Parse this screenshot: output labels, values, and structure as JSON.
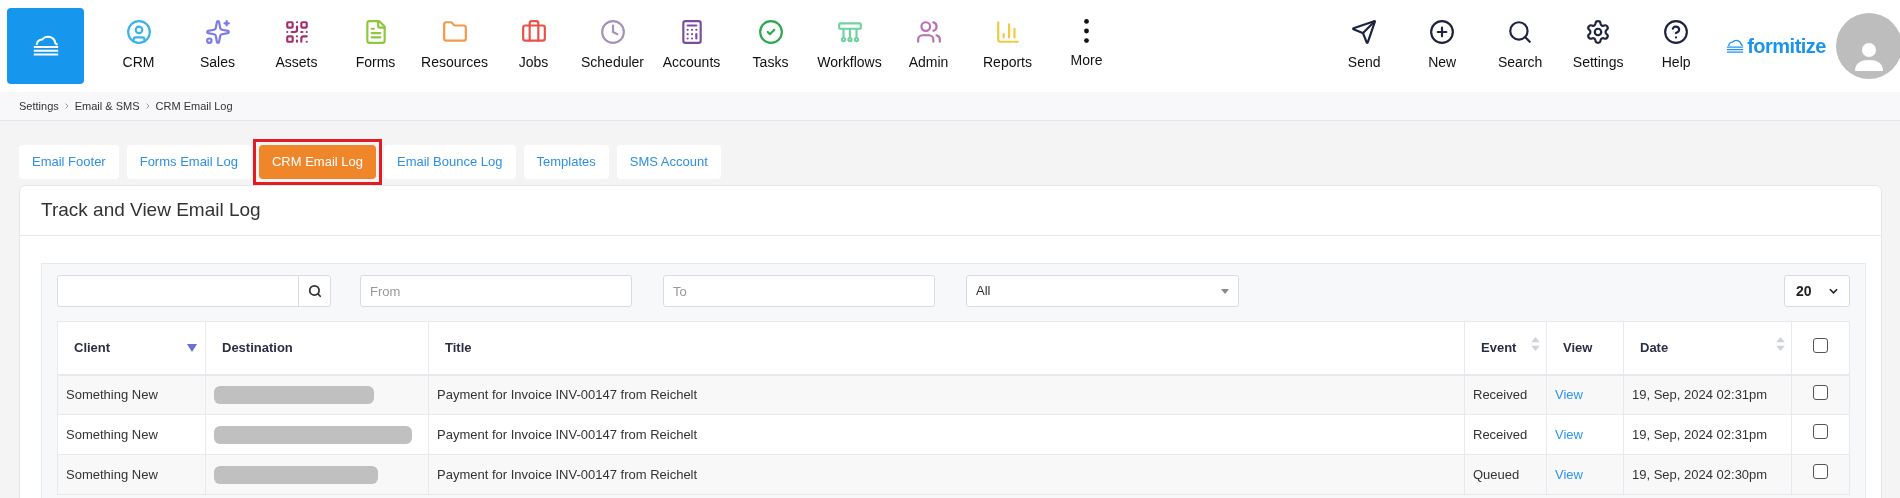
{
  "nav": {
    "items": [
      {
        "label": "CRM"
      },
      {
        "label": "Sales"
      },
      {
        "label": "Assets"
      },
      {
        "label": "Forms"
      },
      {
        "label": "Resources"
      },
      {
        "label": "Jobs"
      },
      {
        "label": "Scheduler"
      },
      {
        "label": "Accounts"
      },
      {
        "label": "Tasks"
      },
      {
        "label": "Workflows"
      },
      {
        "label": "Admin"
      },
      {
        "label": "Reports"
      },
      {
        "label": "More"
      }
    ],
    "actions": [
      {
        "label": "Send"
      },
      {
        "label": "New"
      },
      {
        "label": "Search"
      },
      {
        "label": "Settings"
      },
      {
        "label": "Help"
      }
    ],
    "brand": "formitize"
  },
  "breadcrumbs": [
    "Settings",
    "Email & SMS",
    "CRM Email Log"
  ],
  "tabs": [
    {
      "label": "Email Footer",
      "selected": false,
      "highlighted": false
    },
    {
      "label": "Forms Email Log",
      "selected": false,
      "highlighted": false
    },
    {
      "label": "CRM Email Log",
      "selected": true,
      "highlighted": true
    },
    {
      "label": "Email Bounce Log",
      "selected": false,
      "highlighted": false
    },
    {
      "label": "Templates",
      "selected": false,
      "highlighted": false
    },
    {
      "label": "SMS Account",
      "selected": false,
      "highlighted": false
    }
  ],
  "panel": {
    "title": "Track and View Email Log",
    "filters": {
      "from": {
        "placeholder": "From"
      },
      "to": {
        "placeholder": "To"
      },
      "event": {
        "value": "All"
      },
      "page_size": {
        "value": "20"
      }
    },
    "table": {
      "columns": [
        {
          "label": "Client",
          "sortable": true,
          "sorted": true
        },
        {
          "label": "Destination",
          "sortable": false,
          "sorted": false
        },
        {
          "label": "Title",
          "sortable": false,
          "sorted": false
        },
        {
          "label": "Event",
          "sortable": true,
          "sorted": false
        },
        {
          "label": "View",
          "sortable": false,
          "sorted": false
        },
        {
          "label": "Date",
          "sortable": true,
          "sorted": false
        }
      ],
      "select_all": {
        "checked": false
      },
      "rows": [
        {
          "client": "Something New",
          "destination": {
            "kind": "redacted"
          },
          "title": "Payment for Invoice INV-00147 from Reichelt",
          "event": "Received",
          "view": "View",
          "date": "19, Sep, 2024 02:31pm",
          "checked": false
        },
        {
          "client": "Something New",
          "destination": {
            "kind": "redacted"
          },
          "title": "Payment for Invoice INV-00147 from Reichelt",
          "event": "Received",
          "view": "View",
          "date": "19, Sep, 2024 02:31pm",
          "checked": false
        },
        {
          "client": "Something New",
          "destination": {
            "kind": "redacted"
          },
          "title": "Payment for Invoice INV-00147 from Reichelt",
          "event": "Queued",
          "view": "View",
          "date": "19, Sep, 2024 02:30pm",
          "checked": false
        }
      ]
    }
  }
}
